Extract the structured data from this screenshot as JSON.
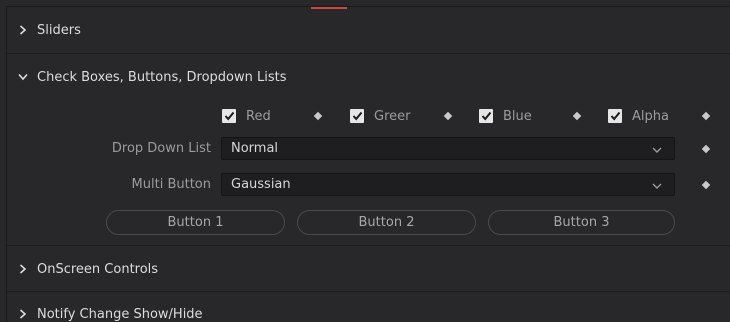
{
  "sections": {
    "sliders": {
      "title": "Sliders",
      "expanded": false
    },
    "check_boxes": {
      "title": "Check Boxes, Buttons, Dropdown Lists",
      "expanded": true,
      "checkboxes": [
        {
          "label": "Red",
          "checked": true
        },
        {
          "label": "Greer",
          "checked": true
        },
        {
          "label": "Blue",
          "checked": true
        },
        {
          "label": "Alpha",
          "checked": true
        }
      ],
      "drop_down_list": {
        "label": "Drop Down List",
        "value": "Normal"
      },
      "multi_button": {
        "label": "Multi Button",
        "value": "Gaussian"
      },
      "buttons": [
        {
          "label": "Button 1"
        },
        {
          "label": "Button 2"
        },
        {
          "label": "Button 3"
        }
      ]
    },
    "onscreen_controls": {
      "title": "OnScreen Controls",
      "expanded": false
    },
    "notify_change": {
      "title": "Notify Change Show/Hide",
      "expanded": false
    }
  },
  "icons": {
    "collapsed": "chevron-right-icon",
    "expanded": "chevron-down-icon",
    "keyframe": "diamond-icon",
    "check": "checkmark-icon"
  },
  "colors": {
    "background": "#28282b",
    "accent": "#c8493d",
    "checkbox": "#e6e6e6"
  }
}
